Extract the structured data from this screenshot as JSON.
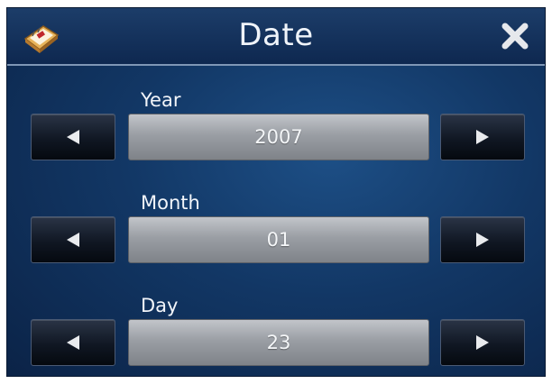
{
  "header": {
    "title": "Date",
    "app_icon": "calendar-icon",
    "close_icon": "close-icon"
  },
  "fields": [
    {
      "label": "Year",
      "value": "2007",
      "decrement_icon": "arrow-left-icon",
      "increment_icon": "arrow-right-icon"
    },
    {
      "label": "Month",
      "value": "01",
      "decrement_icon": "arrow-left-icon",
      "increment_icon": "arrow-right-icon"
    },
    {
      "label": "Day",
      "value": "23",
      "decrement_icon": "arrow-left-icon",
      "increment_icon": "arrow-right-icon"
    }
  ],
  "colors": {
    "background": "#123765",
    "value_box": "#9a9ea4",
    "button": "#101723",
    "text": "#f2f5fa"
  }
}
